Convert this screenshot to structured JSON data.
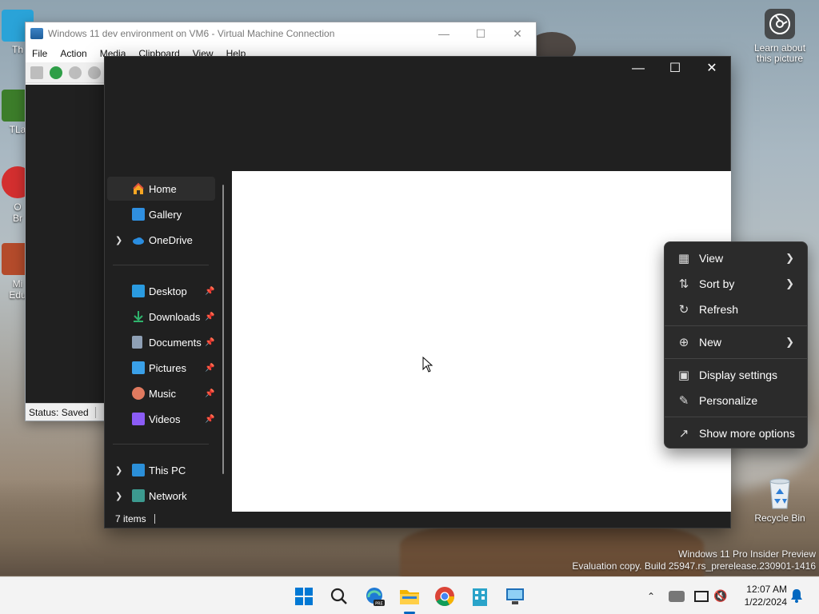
{
  "desktop": {
    "learn_about_picture": "Learn about this picture",
    "recycle_bin": "Recycle Bin",
    "partial_icons": [
      "Th",
      "TLa",
      "O",
      "Br",
      "Mi",
      "Edu"
    ],
    "watermark_line1": "Windows 11 Pro Insider Preview",
    "watermark_line2": "Evaluation copy. Build 25947.rs_prerelease.230901-1416"
  },
  "vm_window": {
    "title": "Windows 11 dev environment on VM6 - Virtual Machine Connection",
    "menu": [
      "File",
      "Action",
      "Media",
      "Clipboard",
      "View",
      "Help"
    ],
    "status": "Status: Saved"
  },
  "explorer": {
    "nav": {
      "home": "Home",
      "gallery": "Gallery",
      "onedrive": "OneDrive",
      "desktop": "Desktop",
      "downloads": "Downloads",
      "documents": "Documents",
      "pictures": "Pictures",
      "music": "Music",
      "videos": "Videos",
      "this_pc": "This PC",
      "network": "Network"
    },
    "status_items": "7 items"
  },
  "context_menu": {
    "view": "View",
    "sort_by": "Sort by",
    "refresh": "Refresh",
    "new": "New",
    "display_settings": "Display settings",
    "personalize": "Personalize",
    "show_more_options": "Show more options"
  },
  "taskbar": {
    "time": "12:07 AM",
    "date": "1/22/2024",
    "accent_color": "#0067c0"
  }
}
